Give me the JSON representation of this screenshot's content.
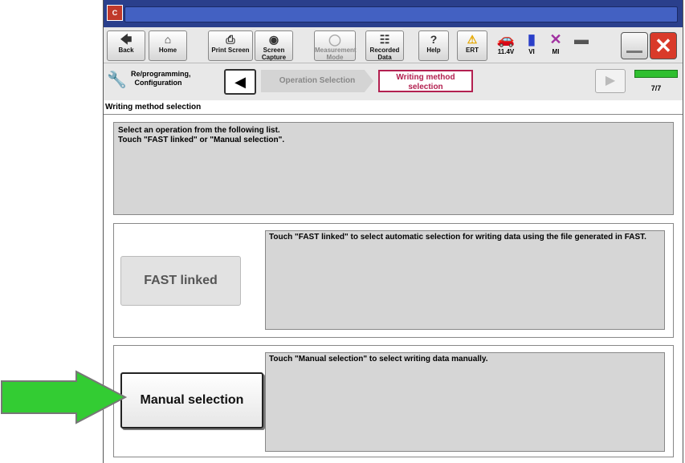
{
  "toolbar": {
    "back": "Back",
    "home": "Home",
    "print": "Print Screen",
    "screen_capture": "Screen Capture",
    "measurement": "Measurement Mode",
    "recorded": "Recorded Data",
    "help": "Help",
    "ert": "ERT",
    "voltage": "11.4V",
    "vi": "VI",
    "mi": "MI"
  },
  "breadcrumb": {
    "first": "Re/programming, Configuration",
    "step1": "Operation Selection",
    "step2": "Writing method selection",
    "progress": "7/7"
  },
  "section_title": "Writing method selection",
  "instructions": {
    "line1": "Select an operation from the following list.",
    "line2": "Touch \"FAST linked\" or \"Manual selection\"."
  },
  "options": {
    "fast": {
      "label": "FAST linked",
      "description": "Touch \"FAST linked\" to select automatic selection for writing data using the file generated in FAST."
    },
    "manual": {
      "label": "Manual selection",
      "description": "Touch \"Manual selection\" to select writing data manually."
    }
  },
  "colors": {
    "titlebar": "#2a3f8c",
    "active_step": "#b32050",
    "arrow": "#33cc33",
    "close": "#d93a2a"
  }
}
